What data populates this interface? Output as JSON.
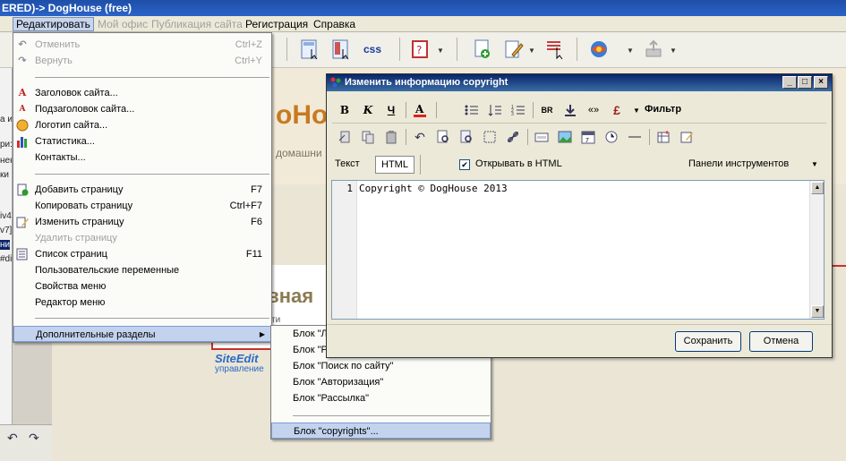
{
  "window": {
    "title": "ERED)-> DogHouse (free)"
  },
  "menubar": {
    "items": [
      {
        "label": "Редактировать",
        "state": "active"
      },
      {
        "label": "Мой офис",
        "state": "disabled"
      },
      {
        "label": "Публикация сайта",
        "state": "disabled"
      },
      {
        "label": "Регистрация",
        "state": "normal"
      },
      {
        "label": "Справка",
        "state": "normal"
      }
    ]
  },
  "toolbar": {
    "css_label": "css"
  },
  "edit_menu": {
    "items": [
      {
        "label": "Отменить",
        "shortcut": "Ctrl+Z",
        "disabled": true,
        "icon": "undo-icon"
      },
      {
        "label": "Вернуть",
        "shortcut": "Ctrl+Y",
        "disabled": true,
        "icon": "redo-icon"
      },
      {
        "label": "Заголовок сайта...",
        "shortcut": "",
        "icon": "site-title-icon"
      },
      {
        "label": "Подзаголовок сайта...",
        "shortcut": "",
        "icon": "site-subtitle-icon"
      },
      {
        "label": "Логотип сайта...",
        "shortcut": "",
        "icon": "logo-icon"
      },
      {
        "label": "Статистика...",
        "shortcut": "",
        "icon": "statistics-icon"
      },
      {
        "label": "Контакты...",
        "shortcut": "",
        "icon": ""
      },
      {
        "label": "Добавить страницу",
        "shortcut": "F7",
        "icon": "add-page-icon"
      },
      {
        "label": "Копировать страницу",
        "shortcut": "Ctrl+F7",
        "icon": ""
      },
      {
        "label": "Изменить страницу",
        "shortcut": "F6",
        "icon": "edit-page-icon"
      },
      {
        "label": "Удалить страницу",
        "shortcut": "",
        "disabled": true,
        "icon": ""
      },
      {
        "label": "Список страниц",
        "shortcut": "F11",
        "icon": "page-list-icon"
      },
      {
        "label": "Пользовательские переменные",
        "shortcut": "",
        "icon": ""
      },
      {
        "label": "Свойства меню",
        "shortcut": "",
        "icon": ""
      },
      {
        "label": "Редактор меню",
        "shortcut": "",
        "icon": ""
      },
      {
        "label": "Дополнительные разделы",
        "shortcut": "",
        "icon": "",
        "submenu": true
      }
    ]
  },
  "submenu": {
    "items": [
      {
        "label": "Блок \"Л"
      },
      {
        "label": "Блок \"Р"
      },
      {
        "label": "Блок \"Поиск по сайту\""
      },
      {
        "label": "Блок \"Авторизация\""
      },
      {
        "label": "Блок \"Рассылка\""
      },
      {
        "label": "Блок \"copyrights\"..."
      }
    ]
  },
  "dialog": {
    "title": "Изменить информацию copyright",
    "filter_label": "Фильтр",
    "tab_text": "Текст",
    "tab_html": "HTML",
    "open_html_label": "Открывать в HTML",
    "open_html_checked": true,
    "panels_label": "Панели инструментов",
    "line_number": "1",
    "code": "Copyright © DogHouse 2013",
    "save_label": "Сохранить",
    "cancel_label": "Отмена"
  },
  "preview": {
    "header_fragment": "oHou",
    "sub_fragment": "домашни",
    "heading_fragment": "авная",
    "small_fragment": "сти",
    "siteedit_label": "SiteEdit",
    "siteedit_sub": "управление"
  },
  "left_strip": {
    "fragments": [
      "а и",
      "ри:",
      "нен",
      "ки",
      "iv4",
      "v7]",
      "ни",
      "#di"
    ]
  }
}
